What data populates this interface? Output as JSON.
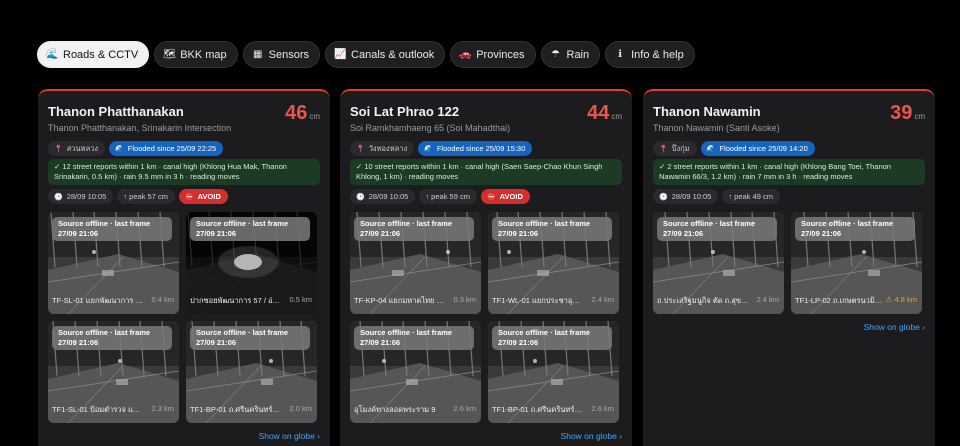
{
  "tabs": [
    {
      "label": "Roads & CCTV",
      "icon": "🌊",
      "active": true
    },
    {
      "label": "BKK map",
      "icon": "🗺"
    },
    {
      "label": "Sensors",
      "icon": "▦"
    },
    {
      "label": "Canals & outlook",
      "icon": "📈"
    },
    {
      "label": "Provinces",
      "icon": "🚗"
    },
    {
      "label": "Rain",
      "icon": "☂"
    },
    {
      "label": "Info & help",
      "icon": "ℹ"
    }
  ],
  "common": {
    "level_unit": "cm",
    "cam_offline": "Source offline · last frame 27/09 21:06",
    "show_on_globe": "Show on globe ›",
    "avoid_label": "AVOID"
  },
  "colors": {
    "accent_red": "#e53935",
    "flood_blue": "#1565c0",
    "report_green": "#1d3a24",
    "link_blue": "#42a5f5"
  },
  "cards": [
    {
      "title": "Thanon Phatthanakan",
      "subtitle": "Thanon Phatthanakan, Srinakarin Intersection",
      "level": "46",
      "district": "สวนหลวง",
      "flooded": "Flooded since 25/09 22:25",
      "reports": "✓ 12 street reports within 1 km · canal high (Khlong Hua Mak, Thanon Srinakarin, 0.5 km) · rain 9.5 mm in 3 h · reading moves",
      "time": "28/09 10:05",
      "peak": "↑ peak 57 cm",
      "avoid": true,
      "cams": [
        {
          "name": "TF-SL-01 แยกพัฒนาการ / ศรี...",
          "dist": "0.4 km"
        },
        {
          "name": "ปากซอยพัฒนาการ 57 / อ่อนนุช...",
          "dist": "0.5 km"
        },
        {
          "name": "TF1-SL-01 ป้อมตำรวจ แยก...",
          "dist": "2.3 km"
        },
        {
          "name": "TF1-BP-01 ถ.ศรีนครินทร์ ตัด...",
          "dist": "2.0 km"
        }
      ]
    },
    {
      "title": "Soi Lat Phrao 122",
      "subtitle": "Soi Ramkhamhaeng 65 (Soi Mahadthai)",
      "level": "44",
      "district": "วังทองหลาง",
      "flooded": "Flooded since 25/09 15:30",
      "reports": "✓ 10 street reports within 1 km · canal high (Saen Saep-Chao Khun Singh Khlong, 1 km) · reading moves",
      "time": "28/09 10:05",
      "peak": "↑ peak 59 cm",
      "avoid": true,
      "cams": [
        {
          "name": "TF-KP-04 แยกมหาดไทย / ...",
          "dist": "0.3 km"
        },
        {
          "name": "TF1-WL-01 แยกประชาอุทิศ...",
          "dist": "2.4 km"
        },
        {
          "name": "อุโมงค์ทางลอดพระราม 9",
          "dist": "2.6 km"
        },
        {
          "name": "TF1-BP-01 ถ.ศรีนครินทร์ ตัด...",
          "dist": "2.6 km"
        }
      ]
    },
    {
      "title": "Thanon Nawamin",
      "subtitle": "Thanon Nawamin (Santi Asoke)",
      "level": "39",
      "district": "บึงกุ่ม",
      "flooded": "Flooded since 25/09 14:20",
      "reports": "✓ 2 street reports within 1 km · canal high (Khlong Bang Toei, Thanon Nawamin 66/3, 1.2 km) · rain 7 mm in 3 h · reading moves",
      "time": "28/09 10:05",
      "peak": "↑ peak 49 cm",
      "avoid": false,
      "cams": [
        {
          "name": "ถ.ประเสริฐมนูกิจ ตัด ถ.สุขาภิบาล...",
          "dist": "2.4 km"
        },
        {
          "name": "TF1-LP-02 ถ.เกษตรนวมินทร์",
          "dist": "⚠ 4.8 km",
          "warn": true
        }
      ]
    }
  ]
}
